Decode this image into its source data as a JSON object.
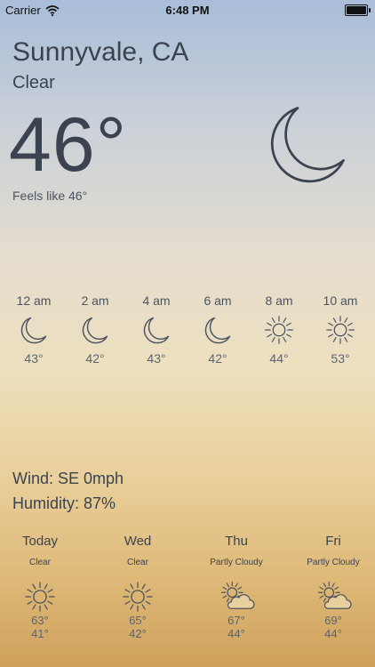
{
  "status_bar": {
    "carrier": "Carrier",
    "time": "6:48 PM",
    "battery": "full"
  },
  "current": {
    "location": "Sunnyvale, CA",
    "condition": "Clear",
    "temperature": "46°",
    "feels_like": "Feels like 46°",
    "icon": "moon-icon"
  },
  "hourly": [
    {
      "time": "12 am",
      "icon": "moon-icon",
      "temp": "43°"
    },
    {
      "time": "2 am",
      "icon": "moon-icon",
      "temp": "42°"
    },
    {
      "time": "4 am",
      "icon": "moon-icon",
      "temp": "43°"
    },
    {
      "time": "6 am",
      "icon": "moon-icon",
      "temp": "42°"
    },
    {
      "time": "8 am",
      "icon": "sun-icon",
      "temp": "44°"
    },
    {
      "time": "10 am",
      "icon": "sun-icon",
      "temp": "53°"
    }
  ],
  "details": {
    "wind": "Wind: SE 0mph",
    "humidity": "Humidity: 87%"
  },
  "daily": [
    {
      "day": "Today",
      "condition": "Clear",
      "icon": "sun-icon",
      "high": "63°",
      "low": "41°"
    },
    {
      "day": "Wed",
      "condition": "Clear",
      "icon": "sun-icon",
      "high": "65°",
      "low": "42°"
    },
    {
      "day": "Thu",
      "condition": "Partly Cloudy",
      "icon": "partly-cloudy-icon",
      "high": "67°",
      "low": "44°"
    },
    {
      "day": "Fri",
      "condition": "Partly Cloudy",
      "icon": "partly-cloudy-icon",
      "high": "69°",
      "low": "44°"
    }
  ]
}
